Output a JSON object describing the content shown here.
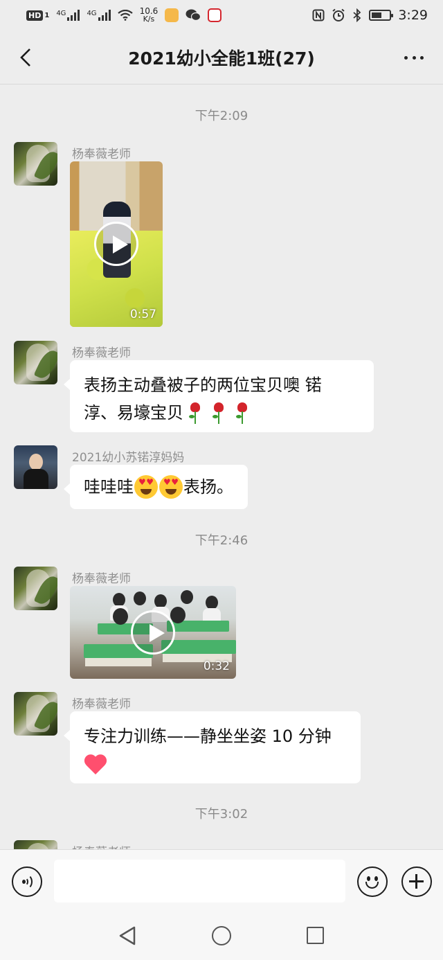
{
  "status_bar": {
    "hd_label": "HD",
    "sim1_label": "4G",
    "sim2_label": "4G",
    "net_speed_value": "10.6",
    "net_speed_unit": "K/s",
    "time": "3:29",
    "battery_fraction": 0.6
  },
  "header": {
    "title": "2021幼小全能1班(27)"
  },
  "messages": [
    {
      "type": "time",
      "text": "下午2:09"
    },
    {
      "type": "video",
      "sender": "杨奉薇老师",
      "duration": "0:57"
    },
    {
      "type": "text",
      "sender": "杨奉薇老师",
      "line1": "表扬主动叠被子的两位宝贝噢 锘",
      "line2": "淳、易壕宝贝",
      "emojis": [
        "rose-icon",
        "rose-icon",
        "rose-icon"
      ]
    },
    {
      "type": "text",
      "sender": "2021幼小苏锘淳妈妈",
      "part1": "哇哇哇",
      "part2": "表扬。",
      "emojis": [
        "heart-eyes-emoji",
        "heart-eyes-emoji"
      ]
    },
    {
      "type": "time",
      "text": "下午2:46"
    },
    {
      "type": "video",
      "sender": "杨奉薇老师",
      "duration": "0:32"
    },
    {
      "type": "text",
      "sender": "杨奉薇老师",
      "line1": "专注力训练——静坐坐姿 10 分钟",
      "emojis": [
        "heart-icon"
      ]
    },
    {
      "type": "time",
      "text": "下午3:02"
    },
    {
      "type": "partial",
      "sender": "杨奉薇老师"
    }
  ],
  "input_bar": {
    "placeholder": "",
    "icons": [
      "voice-icon",
      "emoji-icon",
      "plus-icon"
    ]
  },
  "nav_bar": {
    "icons": [
      "back-triangle-icon",
      "home-circle-icon",
      "recent-square-icon"
    ]
  }
}
